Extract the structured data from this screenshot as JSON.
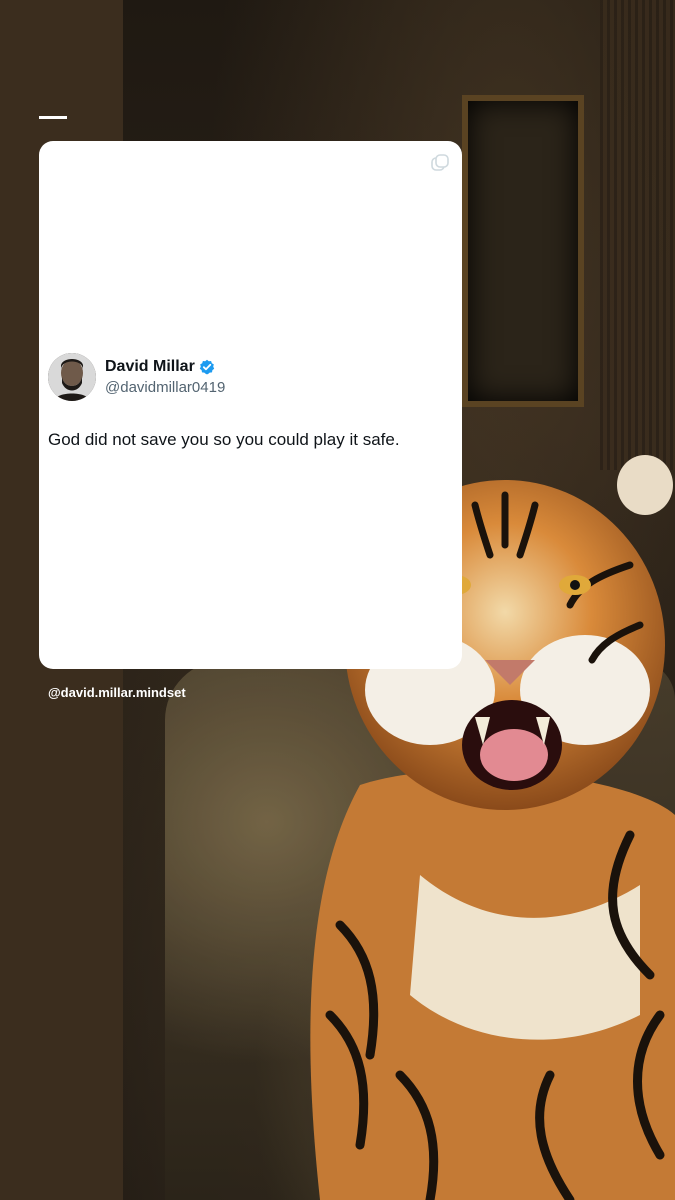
{
  "post": {
    "author_name": "David Millar",
    "author_handle": "@davidmillar0419",
    "text": "God did not save you so you could play it safe.",
    "verified": true
  },
  "watermark": "@david.millar.mindset",
  "colors": {
    "left_strip": "#3b2d1e",
    "card": "#ffffff",
    "verified_badge": "#1d9bf0"
  },
  "icons": {
    "card_corner": "copy-icon",
    "verified": "verified-badge-icon"
  }
}
